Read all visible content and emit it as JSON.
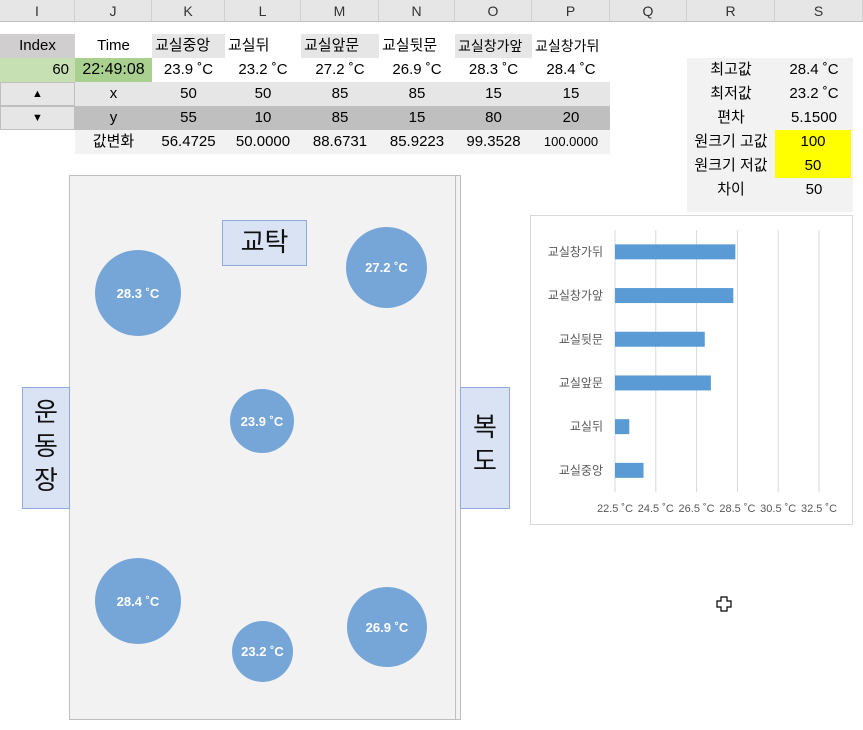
{
  "columns": [
    "I",
    "J",
    "K",
    "L",
    "M",
    "N",
    "O",
    "P",
    "Q",
    "R",
    "S"
  ],
  "table": {
    "header": [
      "Index",
      "Time",
      "교실중앙",
      "교실뒤",
      "교실앞문",
      "교실뒷문",
      "교실창가앞",
      "교실창가뒤"
    ],
    "row1": {
      "index": "60",
      "time": "22:49:08",
      "values": [
        "23.9 ˚C",
        "23.2 ˚C",
        "27.2 ˚C",
        "26.9 ˚C",
        "28.3 ˚C",
        "28.4 ˚C"
      ]
    },
    "x": {
      "label": "x",
      "values": [
        "50",
        "50",
        "85",
        "85",
        "15",
        "15"
      ]
    },
    "y": {
      "label": "y",
      "values": [
        "55",
        "10",
        "85",
        "15",
        "80",
        "20"
      ]
    },
    "change": {
      "label": "값변화",
      "values": [
        "56.4725",
        "50.0000",
        "88.6731",
        "85.9223",
        "99.3528",
        "100.0000"
      ]
    }
  },
  "nav": {
    "up_icon": "▲",
    "down_icon": "▼"
  },
  "stats": [
    {
      "label": "최고값",
      "value": "28.4 ˚C"
    },
    {
      "label": "최저값",
      "value": "23.2 ˚C"
    },
    {
      "label": "편차",
      "value": "5.1500"
    },
    {
      "label": "원크기 고값",
      "value": "100"
    },
    {
      "label": "원크기 저값",
      "value": "50"
    },
    {
      "label": "차이",
      "value": "50"
    }
  ],
  "floor": {
    "desk": "교탁",
    "left_door": "운\n동\n장",
    "right_door": "복\n도",
    "circles": {
      "center": "23.9 ˚C",
      "back": "23.2 ˚C",
      "front_door": "27.2 ˚C",
      "back_door": "26.9 ˚C",
      "window_front": "28.3 ˚C",
      "window_back": "28.4 ˚C"
    }
  },
  "colors": {
    "bar": "#5b9bd5",
    "circle": "#76a6d8",
    "yellow": "#ffff00",
    "green": "#c6e0b4"
  },
  "chart_data": {
    "type": "bar",
    "orientation": "horizontal",
    "categories": [
      "교실창가뒤",
      "교실창가앞",
      "교실뒷문",
      "교실앞문",
      "교실뒤",
      "교실중앙"
    ],
    "values": [
      28.4,
      28.3,
      26.9,
      27.2,
      23.2,
      23.9
    ],
    "xlim": [
      22.5,
      32.5
    ],
    "xticks": [
      "22.5 ˚C",
      "24.5 ˚C",
      "26.5 ˚C",
      "28.5 ˚C",
      "30.5 ˚C",
      "32.5 ˚C"
    ],
    "grid": true
  }
}
